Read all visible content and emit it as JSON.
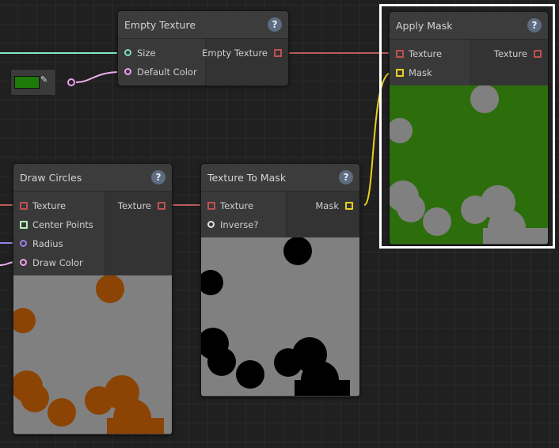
{
  "nodes": {
    "empty_texture": {
      "title": "Empty Texture",
      "help": "?",
      "inputs": [
        "Size",
        "Default Color"
      ],
      "output": "Empty Texture"
    },
    "apply_mask": {
      "title": "Apply Mask",
      "help": "?",
      "inputs": [
        "Texture",
        "Mask"
      ],
      "output": "Texture"
    },
    "draw_circles": {
      "title": "Draw Circles",
      "help": "?",
      "inputs": [
        "Texture",
        "Center Points",
        "Radius",
        "Draw Color"
      ],
      "output": "Texture"
    },
    "texture_to_mask": {
      "title": "Texture To Mask",
      "help": "?",
      "inputs": [
        "Texture",
        "Inverse?"
      ],
      "output": "Mask"
    }
  },
  "color_field": {
    "value": "#1d7a08",
    "icon": "eyedropper-icon"
  },
  "colors": {
    "texture_port": "#c05050",
    "mask_port": "#e8d020",
    "size_port": "#7fe0b8",
    "color_port": "#f0a0f0",
    "radius_port": "#9a80e8",
    "points_port": "#b8f0b8",
    "wire_texture": "#b85a5a",
    "wire_size": "#7fe8c0",
    "wire_color": "#f0b0f0",
    "wire_mask": "#e8d020",
    "wire_radius": "#9a80e8",
    "preview_gray": "#808080",
    "preview_green": "#2c6e0c",
    "preview_brown": "#8b4404",
    "preview_black": "#000000"
  }
}
